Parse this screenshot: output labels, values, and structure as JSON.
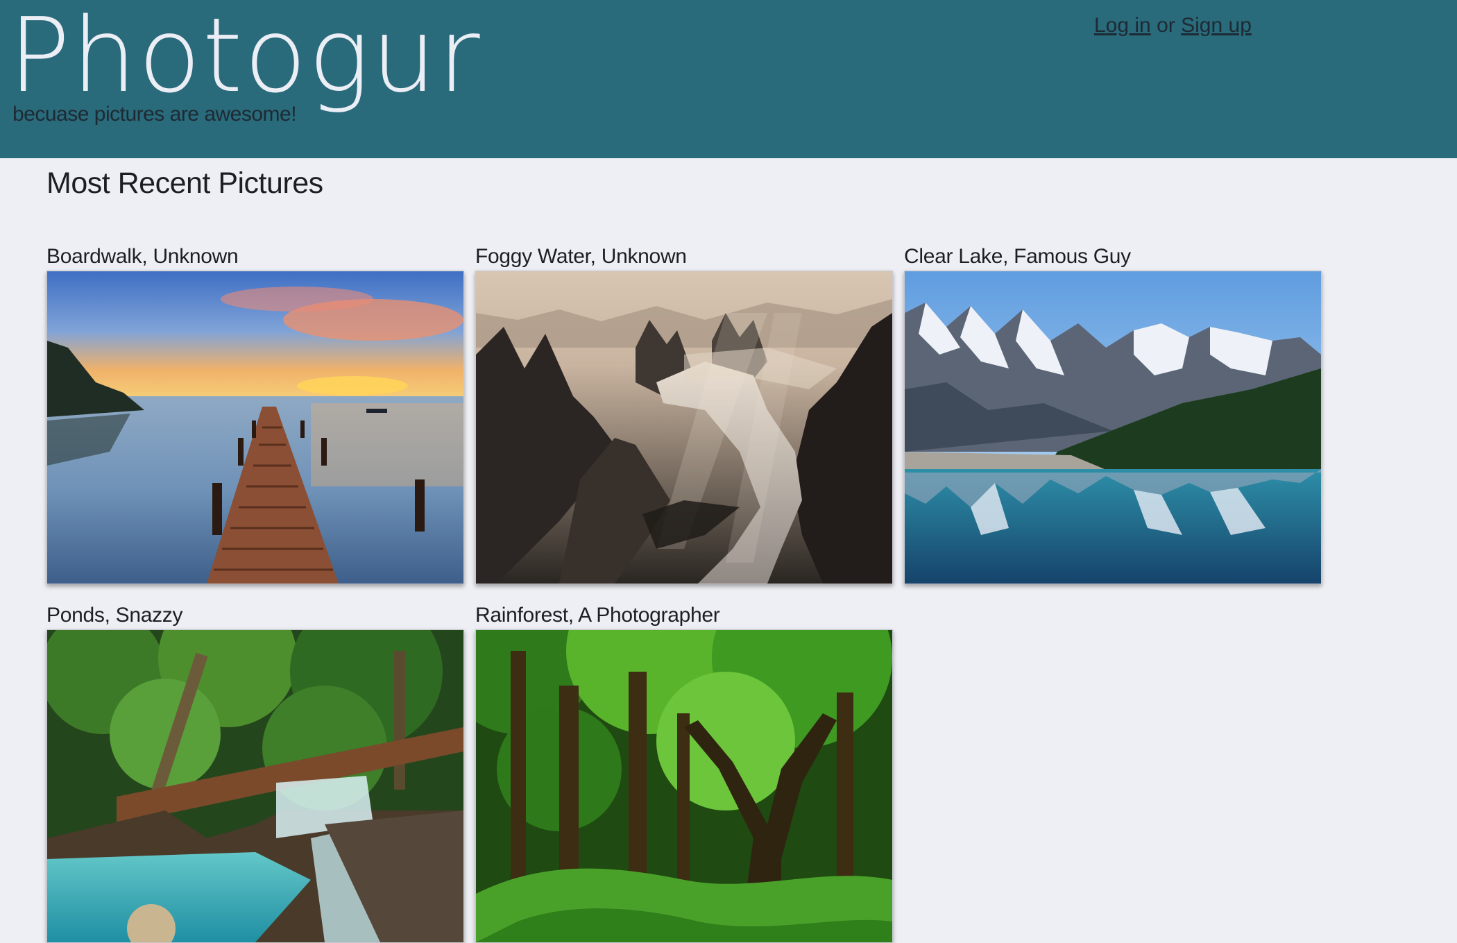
{
  "header": {
    "logo": "Photogur",
    "tagline": "becuase pictures are awesome!",
    "login_label": "Log in",
    "or_text": "or",
    "signup_label": "Sign up"
  },
  "main": {
    "section_title": "Most Recent Pictures",
    "pictures": [
      {
        "caption": "Boardwalk, Unknown",
        "image": "boardwalk-sunset-photo"
      },
      {
        "caption": "Foggy Water, Unknown",
        "image": "foggy-mountains-river-photo"
      },
      {
        "caption": "Clear Lake, Famous Guy",
        "image": "mountain-lake-reflection-photo"
      },
      {
        "caption": "Ponds, Snazzy",
        "image": "jungle-waterfall-pond-photo"
      },
      {
        "caption": "Rainforest, A Photographer",
        "image": "green-rainforest-photo"
      }
    ]
  },
  "colors": {
    "header_bg": "#296a7b",
    "page_bg": "#eeeff4",
    "logo_text": "#eceef6"
  }
}
